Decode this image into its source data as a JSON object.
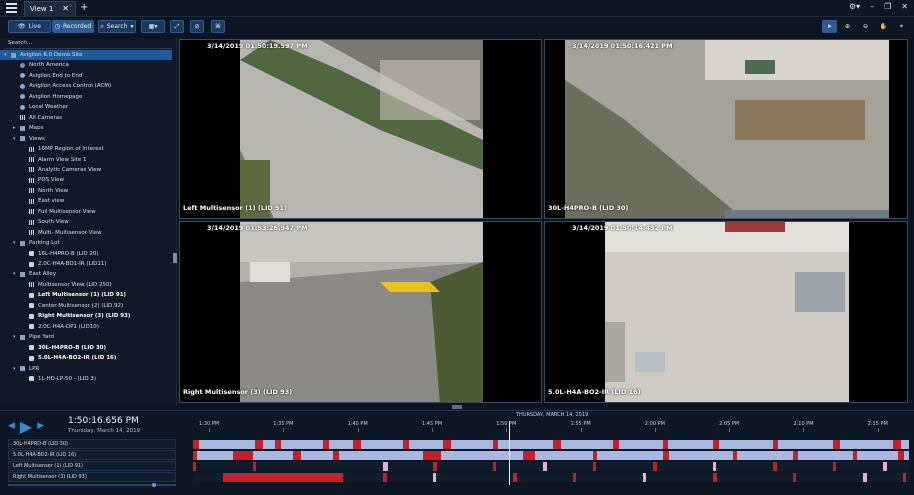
{
  "window": {
    "tab_label": "View 1",
    "tab_close": "✕",
    "tab_add": "+"
  },
  "toolbar": {
    "live_label": "Live",
    "recorded_label": "Recorded",
    "search_label": "Search"
  },
  "sidebar": {
    "search_placeholder": "Search...",
    "tree": [
      {
        "label": "Avigilon 6.0 Demo Site",
        "level": 0,
        "icon": "site",
        "arrow": "▾",
        "selected": true
      },
      {
        "label": "North America",
        "level": 1,
        "icon": "globe"
      },
      {
        "label": "Avigilon End to End",
        "level": 1,
        "icon": "link"
      },
      {
        "label": "Avigilon Access Control (ACM)",
        "level": 1,
        "icon": "link"
      },
      {
        "label": "Avigilon Homepage",
        "level": 1,
        "icon": "link"
      },
      {
        "label": "Local Weather",
        "level": 1,
        "icon": "link"
      },
      {
        "label": "All Cameras",
        "level": 1,
        "icon": "grid"
      },
      {
        "label": "Maps",
        "level": 1,
        "icon": "folder",
        "arrow": "▸"
      },
      {
        "label": "Views",
        "level": 1,
        "icon": "folder",
        "arrow": "▾"
      },
      {
        "label": "16MP Region of Interest",
        "level": 2,
        "icon": "grid"
      },
      {
        "label": "Alarm View Site 1",
        "level": 2,
        "icon": "grid"
      },
      {
        "label": "Analytic Cameras View",
        "level": 2,
        "icon": "grid"
      },
      {
        "label": "POS View",
        "level": 2,
        "icon": "grid"
      },
      {
        "label": "North View",
        "level": 2,
        "icon": "grid"
      },
      {
        "label": "East view",
        "level": 2,
        "icon": "grid"
      },
      {
        "label": "Full Multisensor View",
        "level": 2,
        "icon": "grid"
      },
      {
        "label": "South View",
        "level": 2,
        "icon": "grid"
      },
      {
        "label": "Multi- Multisensor View",
        "level": 2,
        "icon": "grid"
      },
      {
        "label": "Parking Lot",
        "level": 1,
        "icon": "folder",
        "arrow": "▾"
      },
      {
        "label": "16L-H4PRO-B (LID 20)",
        "level": 2,
        "icon": "cam"
      },
      {
        "label": "2.0C-H4A-BO1-IR (LID11)",
        "level": 2,
        "icon": "cam"
      },
      {
        "label": "East Alley",
        "level": 1,
        "icon": "folder",
        "arrow": "▾"
      },
      {
        "label": "Multisensor View (LID 250)",
        "level": 2,
        "icon": "grid"
      },
      {
        "label": "Left Multisensor (1) (LID 91)",
        "level": 2,
        "icon": "cam",
        "bold": true
      },
      {
        "label": "Center Multisensor (2) (LID 92)",
        "level": 2,
        "icon": "cam"
      },
      {
        "label": "Right Multisensor (3) (LID 93)",
        "level": 2,
        "icon": "cam",
        "bold": true
      },
      {
        "label": "2.0C-H4A-DP1 (LID10)",
        "level": 2,
        "icon": "cam"
      },
      {
        "label": "Pipe Yard",
        "level": 1,
        "icon": "folder",
        "arrow": "▾"
      },
      {
        "label": "30L-H4PRO-B (LID 30)",
        "level": 2,
        "icon": "cam",
        "bold": true
      },
      {
        "label": "5.0L-H4A-BO2-IR (LID 16)",
        "level": 2,
        "icon": "cam",
        "bold": true
      },
      {
        "label": "LPR",
        "level": 1,
        "icon": "folder",
        "arrow": "▾"
      },
      {
        "label": "1L-HD-LP-50 - (LID 3)",
        "level": 2,
        "icon": "cam"
      }
    ]
  },
  "tiles": [
    {
      "timestamp": "3/14/2019 01:50:19.597 PM",
      "camera": "Left Multisensor (1) (LID 91)"
    },
    {
      "timestamp": "3/14/2019 01:50:16.421 PM",
      "camera": "30L-H4PRO-B (LID 30)"
    },
    {
      "timestamp": "3/14/2019 01:53:26.947 PM",
      "camera": "Right Multisensor (3) (LID 93)"
    },
    {
      "timestamp": "3/14/2019 01:50:14.492 PM",
      "camera": "5.0L-H4A-BO2-IR (LID 16)"
    }
  ],
  "timeline": {
    "current_time": "1:50:16.656 PM",
    "current_date": "Thursday, March 14, 2019",
    "date_header": "THURSDAY, MARCH 14, 2019",
    "ticks": [
      "1:30 PM",
      "1:35 PM",
      "1:40 PM",
      "1:45 PM",
      "1:50 PM",
      "1:55 PM",
      "2:00 PM",
      "2:05 PM",
      "2:10 PM",
      "2:15 PM"
    ],
    "rows": [
      "30L-H4PRO-B (LID 30)",
      "5.0L-H4A-BO2-IR (LID 16)",
      "Left Multisensor (1) (LID 91)",
      "Right Multisensor (3) (LID 93)"
    ],
    "colors": {
      "recording": "#a8b8e0",
      "motion": "#c4202c",
      "event": "#e8b0c8"
    }
  }
}
